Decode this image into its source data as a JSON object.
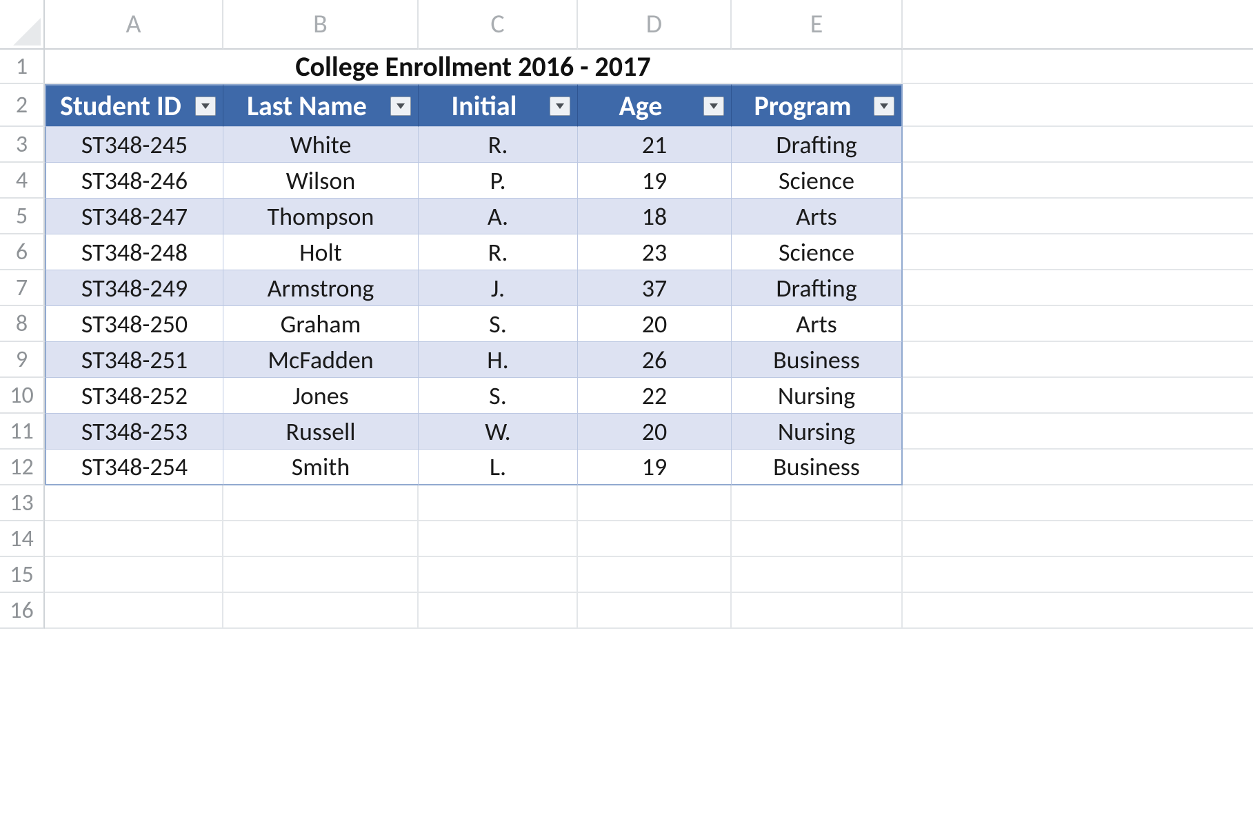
{
  "columns": {
    "letters": [
      "A",
      "B",
      "C",
      "D",
      "E"
    ],
    "widths": [
      259,
      283,
      231,
      223,
      248
    ],
    "overflow_width": 508
  },
  "rows": {
    "count": 16,
    "heights": {
      "r1": 50,
      "r2": 62,
      "default": 52
    }
  },
  "title": "College Enrollment 2016 - 2017",
  "table": {
    "headers": [
      "Student ID",
      "Last Name",
      "Initial",
      "Age",
      "Program"
    ],
    "data": [
      [
        "ST348-245",
        "White",
        "R.",
        "21",
        "Drafting"
      ],
      [
        "ST348-246",
        "Wilson",
        "P.",
        "19",
        "Science"
      ],
      [
        "ST348-247",
        "Thompson",
        "A.",
        "18",
        "Arts"
      ],
      [
        "ST348-248",
        "Holt",
        "R.",
        "23",
        "Science"
      ],
      [
        "ST348-249",
        "Armstrong",
        "J.",
        "37",
        "Drafting"
      ],
      [
        "ST348-250",
        "Graham",
        "S.",
        "20",
        "Arts"
      ],
      [
        "ST348-251",
        "McFadden",
        "H.",
        "26",
        "Business"
      ],
      [
        "ST348-252",
        "Jones",
        "S.",
        "22",
        "Nursing"
      ],
      [
        "ST348-253",
        "Russell",
        "W.",
        "20",
        "Nursing"
      ],
      [
        "ST348-254",
        "Smith",
        "L.",
        "19",
        "Business"
      ]
    ]
  },
  "colors": {
    "header_bg": "#3e69a9",
    "band_even": "#dde2f2",
    "band_odd": "#ffffff",
    "grid_line": "#e3e6e9"
  }
}
